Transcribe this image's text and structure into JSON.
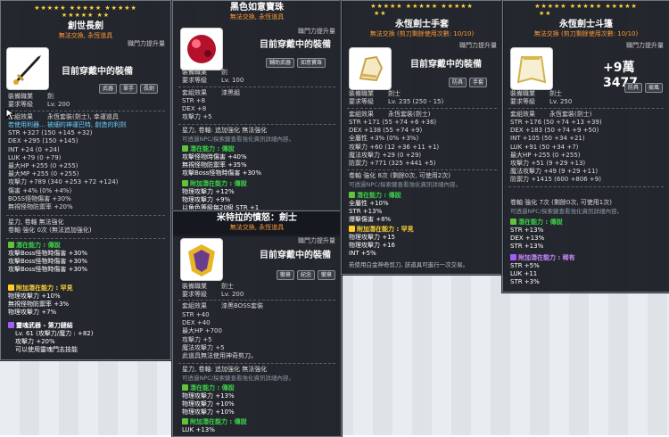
{
  "panel1": {
    "stars_top": "★★★★★ ★★★★★ ★★★★★",
    "stars_bottom": "★★★★★ ★★",
    "title": "創世長劍",
    "sub": "無法交換, 永恆道具",
    "growth": "職門力提升量",
    "equip_label": "目前穿戴中的裝備",
    "tags": [
      "武器",
      "單手",
      "長劍"
    ],
    "job_label": "裝備職業",
    "job_value": "劍",
    "req_label": "要求等級",
    "req_value": "Lv. 200",
    "set_label": "套組效果",
    "set_value": "永恆套裝(劍士), 幸運道具",
    "lines": [
      "若使用利器... 被細的神運巴特, 創造的利劍",
      "STR +327 (150 +145 +32)",
      "DEX +295 (150 +145)",
      "INT +24 (0 +24)",
      "LUK +79 (0 +79)",
      "最大HP +255 (0 +255)",
      "最大MP +255 (0 +255)",
      "攻擊力 +789 (340 +253 +72 +124)",
      "傷害 +4% (0% +4%)",
      "BOSS怪物傷害 +30%",
      "無視怪物防禦率 +20%"
    ],
    "star_force": "星力, 卷軸 無法強化",
    "scroll": "卷軸 強化 0次 (無法追加強化)",
    "potential_head": "潛在能力 : 傳說",
    "potentials": [
      "攻擊Boss怪物時傷害 +30%",
      "攻擊Boss怪物時傷害 +30%",
      "攻擊Boss怪物時傷害 +30%"
    ],
    "add_head": "附加潛在能力 : 罕見",
    "add_potentials": [
      "物理攻擊力 +10%",
      "無視怪物防禦率 +3%",
      "物理攻擊力 +7%"
    ],
    "soul_label": "靈魂武器 - 第刀鏈結",
    "soul_lines": [
      "Lv. 61 (攻擊力/魔力 : +82)",
      "攻擊力 +20%",
      "可以使用靈魂門志技能"
    ]
  },
  "panel2": {
    "title": "黑色如意寶珠",
    "sub": "無法交換, 永恆道具",
    "growth": "職門力提升量",
    "equip_label": "目前穿戴中的裝備",
    "tags": [
      "輔助武器",
      "如意寶珠"
    ],
    "job_label": "裝備職業",
    "job_value": "劍",
    "req_label": "要求等級",
    "req_value": "Lv. 100",
    "set_label": "套組效果",
    "set_value": "漆黑組",
    "lines": [
      "STR +8",
      "DEX +8",
      "攻擊力 +5"
    ],
    "star_force": "星力, 卷軸: 追加強化 無法強化",
    "note": "可透過NPC/探索鍵查看強化資訊詳細內容。",
    "potential_head": "潛在能力 : 傳說",
    "potentials": [
      "攻擊怪物時傷害 +40%",
      "無視怪物防禦率 +35%",
      "攻擊Boss怪物時傷害 +30%"
    ],
    "add_head": "附加潛在能力 : 傳說",
    "add_potentials": [
      "物理攻擊力 +12%",
      "物理攻擊力 +9%",
      "以角色等級每20級 STR +1"
    ]
  },
  "panel3": {
    "title": "米特拉的憤怒：劍士",
    "sub": "無法交換, 永恆道具",
    "growth": "職門力提升量",
    "equip_label": "目前穿戴中的裝備",
    "tags": [
      "徽章",
      "紀念",
      "徽章"
    ],
    "job_label": "裝備職業",
    "job_value": "劍士",
    "req_label": "要求等級",
    "req_value": "Lv. 200",
    "set_label": "套組效果",
    "set_value": "漆黑BOSS套裝",
    "lines": [
      "STR +40",
      "DEX +40",
      "最大HP +700",
      "攻擊力 +5",
      "魔法攻擊力 +5"
    ],
    "extra": "此道具無法使用神奇剪刀。",
    "star_force": "星力, 卷軸: 追加強化 無法強化",
    "note": "可透過NPC/探索鍵查看強化資訊詳細內容。",
    "potential_head": "潛在能力 : 傳說",
    "potentials": [
      "物理攻擊力 +13%",
      "物理攻擊力 +10%",
      "物理攻擊力 +10%"
    ],
    "add_head": "附加潛在能力 : 傳說",
    "add_potentials": [
      "LUK +13%"
    ]
  },
  "panel4": {
    "stars_top": "★★★★★ ★★★★★ ★★★★★",
    "stars_bottom": "★★",
    "title": "永恆劍士手套",
    "sub": "無法交換 (剪刀剩餘使用次數: 10/10)",
    "growth": "職門力提升量",
    "equip_label": "目前穿戴中的裝備",
    "tags": [
      "防具",
      "手套"
    ],
    "job_label": "裝備職業",
    "job_value": "劍士",
    "req_label": "要求等級",
    "req_value": "Lv. 235 (250 - 15)",
    "set_label": "套組效果",
    "set_value": "永恆套裝(劍士)",
    "lines": [
      "STR +171 (55 +74 +6 +36)",
      "DEX +138 (55 +74 +9)",
      "全屬性 +3% (0% +3%)",
      "攻擊力 +60 (12 +36 +11 +1)",
      "魔法攻擊力 +29 (0 +29)",
      "防禦力 +771 (325 +441 +5)"
    ],
    "scroll": "卷軸 強化 8次 (剩餘0次, 可使用2次)",
    "note": "可透過NPC/探索鍵查看強化資訊詳細內容。",
    "potential_head": "潛在能力 : 傳說",
    "potentials": [
      "全屬性 +10%",
      "STR +13%",
      "爆擊傷害 +8%"
    ],
    "add_head": "附加潛在能力 : 罕見",
    "add_potentials": [
      "物理攻擊力 +15",
      "物理攻擊力 +16",
      "INT +5%"
    ],
    "footer": "若使用白金神奇剪刀, 該道具可進行一次交易。"
  },
  "panel5": {
    "stars_top": "★★★★★ ★★★★★ ★★★★★",
    "stars_bottom": "★★",
    "title": "永恆劍士斗篷",
    "sub": "無法交換 (剪刀剩餘使用次數: 10/10)",
    "growth": "職門力提升量",
    "rating_value": "+9萬 3477",
    "tags": [
      "防具",
      "披風"
    ],
    "job_label": "裝備職業",
    "job_value": "劍士",
    "req_label": "要求等級",
    "req_value": "Lv. 250",
    "set_label": "套組效果",
    "set_value": "永恆套裝(劍士)",
    "lines": [
      "STR +176 (50 +74 +13 +39)",
      "DEX +183 (50 +74 +9 +50)",
      "INT +105 (50 +34 +21)",
      "LUK +91 (50 +34 +7)",
      "最大HP +255 (0 +255)",
      "攻擊力 +51 (9 +29 +13)",
      "魔法攻擊力 +49 (9 +29 +11)",
      "防禦力 +1415 (600 +806 +9)"
    ],
    "scroll": "卷軸 強化 7次 (剩餘0次, 可使用1次)",
    "note": "可透過NPC/探索鍵查看強化資訊詳細內容。",
    "potential_head": "潛在能力 : 傳說",
    "potentials": [
      "STR +13%",
      "DEX +13%",
      "STR +13%"
    ],
    "add_head": "附加潛在能力 : 稀有",
    "add_potentials": [
      "STR +5%",
      "LUK +11",
      "STR +3%"
    ]
  },
  "colors": {
    "panel_bg": "#14181e",
    "legend": "#5ec43a",
    "unique": "#ffcc22",
    "epic": "#a45cff",
    "gold": "#ffd33a"
  }
}
